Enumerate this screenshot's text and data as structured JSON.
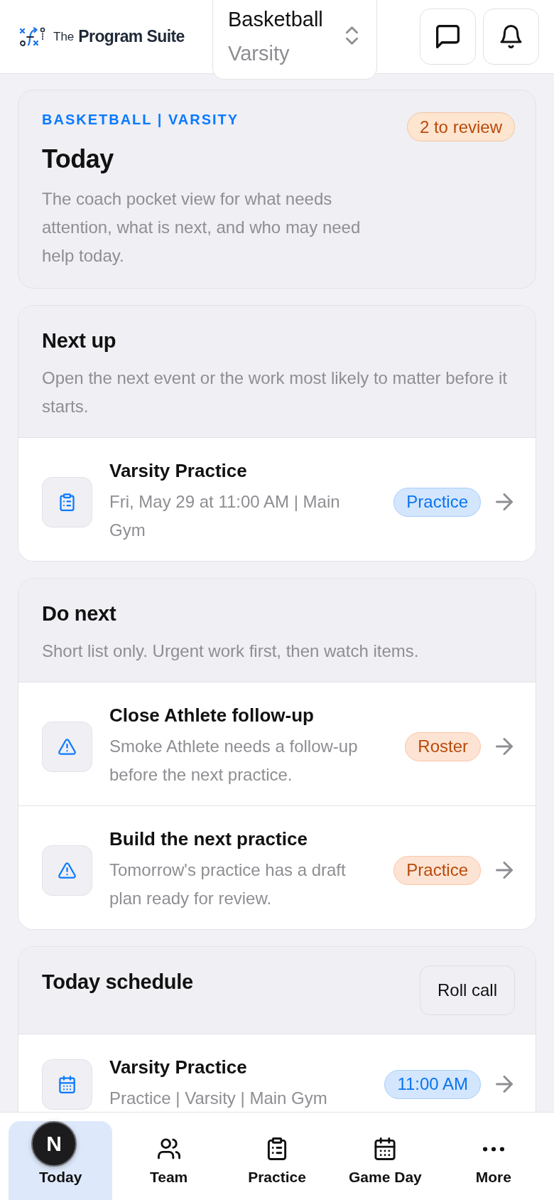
{
  "header": {
    "brand_prefix": "The",
    "brand_name": "Program Suite",
    "team_selector": {
      "sport": "Basketball",
      "level": "Varsity"
    }
  },
  "overview": {
    "eyebrow": "BASKETBALL | VARSITY",
    "title": "Today",
    "description": "The coach pocket view for what needs attention, what is next, and who may need help today.",
    "badge": "2 to review"
  },
  "sections": [
    {
      "title": "Next up",
      "description": "Open the next event or the work most likely to matter before it starts.",
      "items": [
        {
          "kind": "event",
          "title": "Varsity Practice",
          "subtitle": "Fri, May 29 at 11:00 AM | Main Gym",
          "tag": {
            "label": "Practice",
            "color": "#0b74ef"
          }
        }
      ]
    },
    {
      "title": "Do next",
      "description": "Short list only. Urgent work first, then watch items.",
      "items": [
        {
          "kind": "alert",
          "title": "Close Athlete follow-up",
          "subtitle": "Smoke Athlete needs a follow-up before the next practice.",
          "tag": {
            "label": "Roster",
            "color": "#b94a0a"
          }
        },
        {
          "kind": "alert",
          "title": "Build the next practice",
          "subtitle": "Tomorrow's practice has a draft plan ready for review.",
          "tag": {
            "label": "Practice",
            "color": "#b94a0a"
          }
        }
      ]
    },
    {
      "title": "Today schedule",
      "action": "Roll call",
      "items": [
        {
          "kind": "schedule",
          "title": "Varsity Practice",
          "subtitle": "Practice | Varsity | Main Gym",
          "tag": {
            "label": "11:00 AM",
            "color": "#0b74ef"
          }
        }
      ]
    }
  ],
  "bottom_nav": [
    {
      "label": "Today",
      "selected": true
    },
    {
      "label": "Team",
      "kind": "team",
      "selected": false
    },
    {
      "label": "Practice",
      "kind": "practice",
      "selected": false
    },
    {
      "label": "Game Day",
      "kind": "calendar",
      "selected": false
    },
    {
      "label": "More",
      "kind": "more",
      "selected": false
    }
  ],
  "dev_badge": {
    "label": "N"
  }
}
